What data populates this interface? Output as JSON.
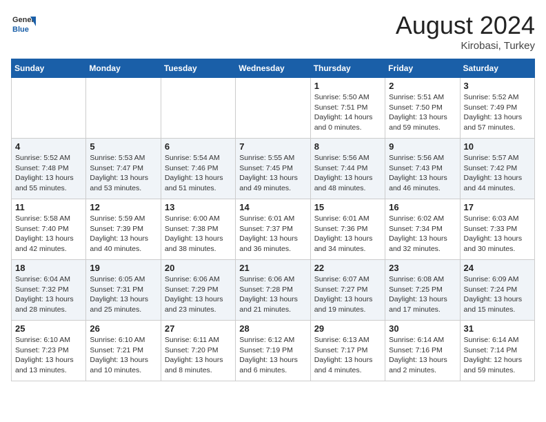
{
  "header": {
    "logo_general": "General",
    "logo_blue": "Blue",
    "month_title": "August 2024",
    "location": "Kirobasi, Turkey"
  },
  "weekdays": [
    "Sunday",
    "Monday",
    "Tuesday",
    "Wednesday",
    "Thursday",
    "Friday",
    "Saturday"
  ],
  "weeks": [
    [
      {
        "day": "",
        "sunrise": "",
        "sunset": "",
        "daylight": ""
      },
      {
        "day": "",
        "sunrise": "",
        "sunset": "",
        "daylight": ""
      },
      {
        "day": "",
        "sunrise": "",
        "sunset": "",
        "daylight": ""
      },
      {
        "day": "",
        "sunrise": "",
        "sunset": "",
        "daylight": ""
      },
      {
        "day": "1",
        "sunrise": "Sunrise: 5:50 AM",
        "sunset": "Sunset: 7:51 PM",
        "daylight": "Daylight: 14 hours and 0 minutes."
      },
      {
        "day": "2",
        "sunrise": "Sunrise: 5:51 AM",
        "sunset": "Sunset: 7:50 PM",
        "daylight": "Daylight: 13 hours and 59 minutes."
      },
      {
        "day": "3",
        "sunrise": "Sunrise: 5:52 AM",
        "sunset": "Sunset: 7:49 PM",
        "daylight": "Daylight: 13 hours and 57 minutes."
      }
    ],
    [
      {
        "day": "4",
        "sunrise": "Sunrise: 5:52 AM",
        "sunset": "Sunset: 7:48 PM",
        "daylight": "Daylight: 13 hours and 55 minutes."
      },
      {
        "day": "5",
        "sunrise": "Sunrise: 5:53 AM",
        "sunset": "Sunset: 7:47 PM",
        "daylight": "Daylight: 13 hours and 53 minutes."
      },
      {
        "day": "6",
        "sunrise": "Sunrise: 5:54 AM",
        "sunset": "Sunset: 7:46 PM",
        "daylight": "Daylight: 13 hours and 51 minutes."
      },
      {
        "day": "7",
        "sunrise": "Sunrise: 5:55 AM",
        "sunset": "Sunset: 7:45 PM",
        "daylight": "Daylight: 13 hours and 49 minutes."
      },
      {
        "day": "8",
        "sunrise": "Sunrise: 5:56 AM",
        "sunset": "Sunset: 7:44 PM",
        "daylight": "Daylight: 13 hours and 48 minutes."
      },
      {
        "day": "9",
        "sunrise": "Sunrise: 5:56 AM",
        "sunset": "Sunset: 7:43 PM",
        "daylight": "Daylight: 13 hours and 46 minutes."
      },
      {
        "day": "10",
        "sunrise": "Sunrise: 5:57 AM",
        "sunset": "Sunset: 7:42 PM",
        "daylight": "Daylight: 13 hours and 44 minutes."
      }
    ],
    [
      {
        "day": "11",
        "sunrise": "Sunrise: 5:58 AM",
        "sunset": "Sunset: 7:40 PM",
        "daylight": "Daylight: 13 hours and 42 minutes."
      },
      {
        "day": "12",
        "sunrise": "Sunrise: 5:59 AM",
        "sunset": "Sunset: 7:39 PM",
        "daylight": "Daylight: 13 hours and 40 minutes."
      },
      {
        "day": "13",
        "sunrise": "Sunrise: 6:00 AM",
        "sunset": "Sunset: 7:38 PM",
        "daylight": "Daylight: 13 hours and 38 minutes."
      },
      {
        "day": "14",
        "sunrise": "Sunrise: 6:01 AM",
        "sunset": "Sunset: 7:37 PM",
        "daylight": "Daylight: 13 hours and 36 minutes."
      },
      {
        "day": "15",
        "sunrise": "Sunrise: 6:01 AM",
        "sunset": "Sunset: 7:36 PM",
        "daylight": "Daylight: 13 hours and 34 minutes."
      },
      {
        "day": "16",
        "sunrise": "Sunrise: 6:02 AM",
        "sunset": "Sunset: 7:34 PM",
        "daylight": "Daylight: 13 hours and 32 minutes."
      },
      {
        "day": "17",
        "sunrise": "Sunrise: 6:03 AM",
        "sunset": "Sunset: 7:33 PM",
        "daylight": "Daylight: 13 hours and 30 minutes."
      }
    ],
    [
      {
        "day": "18",
        "sunrise": "Sunrise: 6:04 AM",
        "sunset": "Sunset: 7:32 PM",
        "daylight": "Daylight: 13 hours and 28 minutes."
      },
      {
        "day": "19",
        "sunrise": "Sunrise: 6:05 AM",
        "sunset": "Sunset: 7:31 PM",
        "daylight": "Daylight: 13 hours and 25 minutes."
      },
      {
        "day": "20",
        "sunrise": "Sunrise: 6:06 AM",
        "sunset": "Sunset: 7:29 PM",
        "daylight": "Daylight: 13 hours and 23 minutes."
      },
      {
        "day": "21",
        "sunrise": "Sunrise: 6:06 AM",
        "sunset": "Sunset: 7:28 PM",
        "daylight": "Daylight: 13 hours and 21 minutes."
      },
      {
        "day": "22",
        "sunrise": "Sunrise: 6:07 AM",
        "sunset": "Sunset: 7:27 PM",
        "daylight": "Daylight: 13 hours and 19 minutes."
      },
      {
        "day": "23",
        "sunrise": "Sunrise: 6:08 AM",
        "sunset": "Sunset: 7:25 PM",
        "daylight": "Daylight: 13 hours and 17 minutes."
      },
      {
        "day": "24",
        "sunrise": "Sunrise: 6:09 AM",
        "sunset": "Sunset: 7:24 PM",
        "daylight": "Daylight: 13 hours and 15 minutes."
      }
    ],
    [
      {
        "day": "25",
        "sunrise": "Sunrise: 6:10 AM",
        "sunset": "Sunset: 7:23 PM",
        "daylight": "Daylight: 13 hours and 13 minutes."
      },
      {
        "day": "26",
        "sunrise": "Sunrise: 6:10 AM",
        "sunset": "Sunset: 7:21 PM",
        "daylight": "Daylight: 13 hours and 10 minutes."
      },
      {
        "day": "27",
        "sunrise": "Sunrise: 6:11 AM",
        "sunset": "Sunset: 7:20 PM",
        "daylight": "Daylight: 13 hours and 8 minutes."
      },
      {
        "day": "28",
        "sunrise": "Sunrise: 6:12 AM",
        "sunset": "Sunset: 7:19 PM",
        "daylight": "Daylight: 13 hours and 6 minutes."
      },
      {
        "day": "29",
        "sunrise": "Sunrise: 6:13 AM",
        "sunset": "Sunset: 7:17 PM",
        "daylight": "Daylight: 13 hours and 4 minutes."
      },
      {
        "day": "30",
        "sunrise": "Sunrise: 6:14 AM",
        "sunset": "Sunset: 7:16 PM",
        "daylight": "Daylight: 13 hours and 2 minutes."
      },
      {
        "day": "31",
        "sunrise": "Sunrise: 6:14 AM",
        "sunset": "Sunset: 7:14 PM",
        "daylight": "Daylight: 12 hours and 59 minutes."
      }
    ]
  ]
}
